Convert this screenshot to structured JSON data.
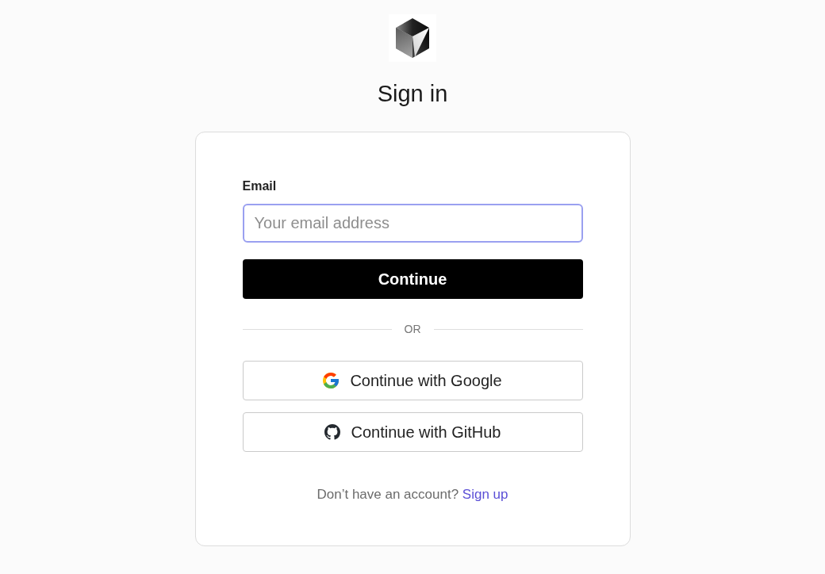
{
  "title": "Sign in",
  "form": {
    "email": {
      "label": "Email",
      "placeholder": "Your email address",
      "focused": true
    },
    "submit": "Continue",
    "divider": "OR",
    "providers": [
      {
        "kind": "google",
        "label": "Continue with Google"
      },
      {
        "kind": "github",
        "label": "Continue with GitHub"
      }
    ],
    "footer": {
      "text": "Don’t have an account?",
      "link": "Sign up"
    }
  }
}
